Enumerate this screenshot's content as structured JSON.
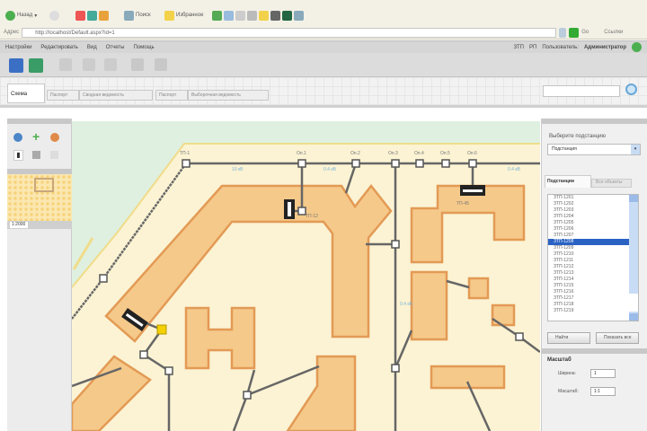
{
  "browser": {
    "back": "Назад",
    "search": "Поиск",
    "favorites": "Избранное",
    "address_label": "Адрес",
    "address": "http://localhost/Default.aspx?id=1",
    "go": "Go",
    "links": "Ссылки"
  },
  "menu": {
    "items": [
      "Настройки",
      "Редактировать",
      "Вид",
      "Отчеты",
      "Помощь"
    ],
    "status1": "ЗТП",
    "status2": "РП",
    "user_label": "Пользователь:",
    "user": "Администратор"
  },
  "tabs": [
    {
      "label": "Схема",
      "active": true
    },
    {
      "label": "Паспорт"
    },
    {
      "label": "Сводная ведомость"
    },
    {
      "label": "Паспорт"
    },
    {
      "label": "Выборочная ведомость"
    }
  ],
  "search": {
    "value": ""
  },
  "left": {
    "scale_label": "1:2000"
  },
  "map": {
    "node_labels": [
      "ТП-1",
      "Оп.1",
      "Оп.2",
      "Оп.3",
      "Оп.4",
      "Оп.5",
      "Оп.6",
      "ТП-12",
      "ТП-45"
    ],
    "feeder_labels": [
      "10 кВ",
      "0.4 кВ",
      "0.4 кВ",
      "0.4 кВ"
    ]
  },
  "right": {
    "select_label": "Выберите подстанцию",
    "select_value": "Подстанция",
    "tab1": "Подстанции",
    "tab2": "Все объекты",
    "items": [
      "ЗТП-1201",
      "ЗТП-1202",
      "ЗТП-1203",
      "ЗТП-1204",
      "ЗТП-1205",
      "ЗТП-1206",
      "ЗТП-1207",
      "ЗТП-1208",
      "ЗТП-1209",
      "ЗТП-1210",
      "ЗТП-1211",
      "ЗТП-1212",
      "ЗТП-1213",
      "ЗТП-1214",
      "ЗТП-1215",
      "ЗТП-1216",
      "ЗТП-1217",
      "ЗТП-1218",
      "ЗТП-1219"
    ],
    "selected_index": 7,
    "btn_find": "Найти",
    "btn_show": "Показать все",
    "section": "Масштаб",
    "field1_label": "Ширина:",
    "field1_value": "1",
    "field2_label": "Масштаб:",
    "field2_value": "1:1"
  },
  "colors": {
    "building": "#f5c98a",
    "building_edge": "#e39a55",
    "ground": "#fbf3d3",
    "water": "#dff0e0",
    "line": "#666666",
    "selected": "#2a62c4"
  }
}
